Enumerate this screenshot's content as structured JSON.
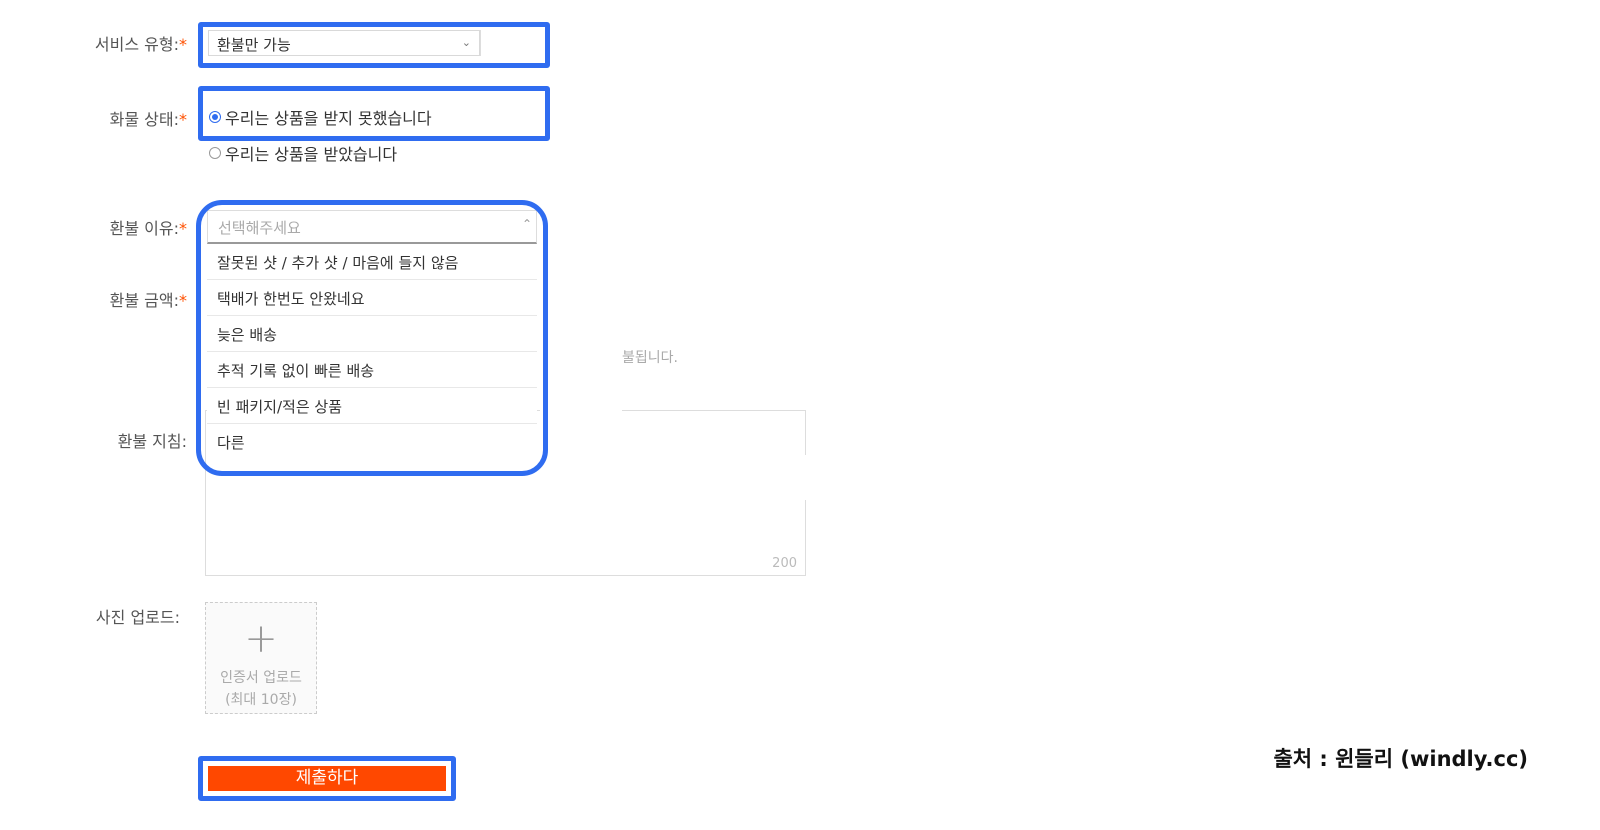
{
  "service_type": {
    "label": "서비스 유형:",
    "value": "환불만 가능"
  },
  "cargo_status": {
    "label": "화물 상태:",
    "options": [
      {
        "label": "우리는 상품을 받지 못했습니다",
        "selected": true
      },
      {
        "label": "우리는 상품을 받았습니다",
        "selected": false
      }
    ]
  },
  "refund_reason": {
    "label": "환불 이유:",
    "placeholder": "선택해주세요",
    "options": [
      "잘못된 샷 / 추가 샷 / 마음에 들지 않음",
      "택배가 한번도 안왔네요",
      "늦은 배송",
      "추적 기록 없이 빠른 배송",
      "빈 패키지/적은 상품",
      "다른"
    ]
  },
  "refund_amount": {
    "label": "환불 금액:",
    "hint_fragment": "불됩니다."
  },
  "refund_guide": {
    "label": "환불 지침:",
    "char_limit": "200"
  },
  "photo_upload": {
    "label": "사진 업로드:",
    "button_line1": "인증서 업로드",
    "button_line2": "(최대 10장)"
  },
  "submit_label": "제출하다",
  "source_text": "출처 : 윈들리 (windly.cc)",
  "colors": {
    "highlight": "#2f6cf0",
    "submit": "#ff4800",
    "required": "#ff5000"
  }
}
